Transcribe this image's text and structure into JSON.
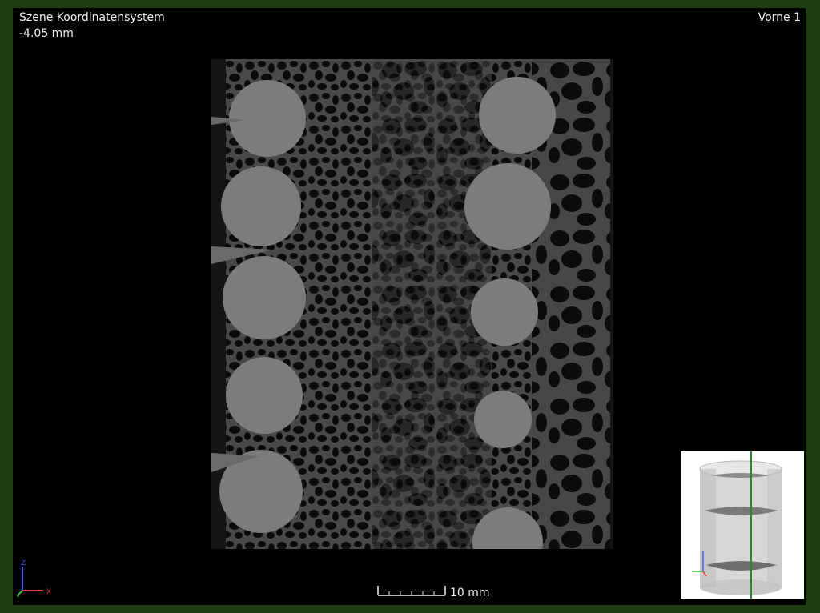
{
  "viewport": {
    "scene_label": "Szene Koordinatensystem",
    "depth_value": "-4.05 mm",
    "view_name": "Vorne 1"
  },
  "scale_bar": {
    "label": "10 mm"
  },
  "axes": {
    "z": "Z",
    "y": "Y",
    "x": "X",
    "colors": {
      "z": "#3a5bff",
      "y": "#2fbf3a",
      "x": "#e23a3a"
    }
  },
  "colors": {
    "frame": "#1f3d12",
    "viewport_bg": "#000000",
    "slice_bg": "#141414",
    "matrix": "#4a4a4a",
    "inclusion": "#7d7d7d",
    "text": "#f2f2f2"
  }
}
